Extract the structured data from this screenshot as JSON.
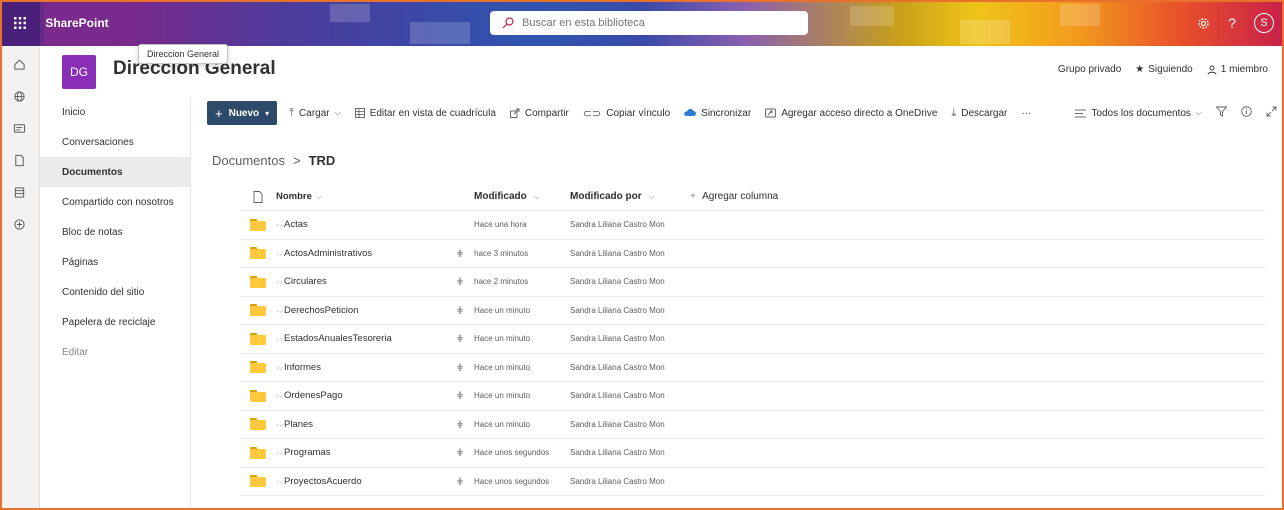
{
  "suitebar": {
    "brand": "SharePoint",
    "search_placeholder": "Buscar en esta biblioteca",
    "avatar_initial": "S",
    "help_label": "?"
  },
  "tooltip": {
    "text": "Direccion General"
  },
  "site": {
    "logo_initials": "DG",
    "title": "Direccion General",
    "privacy": "Grupo privado",
    "follow": "Siguiendo",
    "members": "1 miembro"
  },
  "nav": {
    "items": [
      {
        "label": "Inicio"
      },
      {
        "label": "Conversaciones"
      },
      {
        "label": "Documentos"
      },
      {
        "label": "Compartido con nosotros"
      },
      {
        "label": "Bloc de notas"
      },
      {
        "label": "Páginas"
      },
      {
        "label": "Contenido del sitio"
      },
      {
        "label": "Papelera de reciclaje"
      },
      {
        "label": "Editar"
      }
    ]
  },
  "commandbar": {
    "new_label": "Nuevo",
    "upload": "Cargar",
    "grid_edit": "Editar en vista de cuadrícula",
    "share": "Compartir",
    "copy_link": "Copiar vínculo",
    "sync": "Sincronizar",
    "onedrive_shortcut": "Agregar acceso directo a OneDrive",
    "download": "Descargar",
    "more": "···",
    "view": "Todos los documentos"
  },
  "breadcrumb": {
    "root": "Documentos",
    "separator": ">",
    "current": "TRD"
  },
  "table": {
    "col_name": "Nombre",
    "col_modified": "Modificado",
    "col_modified_by": "Modificado por",
    "add_column": "Agregar columna",
    "rows": [
      {
        "name": "Actas",
        "modified": "Hace una hora",
        "modified_by": "Sandra Liliana Castro Mon",
        "shared": false
      },
      {
        "name": "ActosAdministrativos",
        "modified": "hace 3 minutos",
        "modified_by": "Sandra Liliana Castro Mon",
        "shared": true
      },
      {
        "name": "Circulares",
        "modified": "hace 2 minutos",
        "modified_by": "Sandra Liliana Castro Mon",
        "shared": true
      },
      {
        "name": "DerechosPeticion",
        "modified": "Hace un minuto",
        "modified_by": "Sandra Liliana Castro Mon",
        "shared": true
      },
      {
        "name": "EstadosAnualesTesoreria",
        "modified": "Hace un minuto",
        "modified_by": "Sandra Liliana Castro Mon",
        "shared": true
      },
      {
        "name": "Informes",
        "modified": "Hace un minuto",
        "modified_by": "Sandra Liliana Castro Mon",
        "shared": true
      },
      {
        "name": "OrdenesPago",
        "modified": "Hace un minuto",
        "modified_by": "Sandra Liliana Castro Mon",
        "shared": true
      },
      {
        "name": "Planes",
        "modified": "Hace un minuto",
        "modified_by": "Sandra Liliana Castro Mon",
        "shared": true
      },
      {
        "name": "Programas",
        "modified": "Hace unos segundos",
        "modified_by": "Sandra Liliana Castro Mon",
        "shared": true
      },
      {
        "name": "ProyectosAcuerdo",
        "modified": "Hace unos segundos",
        "modified_by": "Sandra Liliana Castro Mon",
        "shared": true
      }
    ]
  },
  "colors": {
    "new_button": "#2e4a6b",
    "site_logo": "#8a2fb5",
    "folder": "#ffc83d",
    "frame": "#e8722c"
  }
}
